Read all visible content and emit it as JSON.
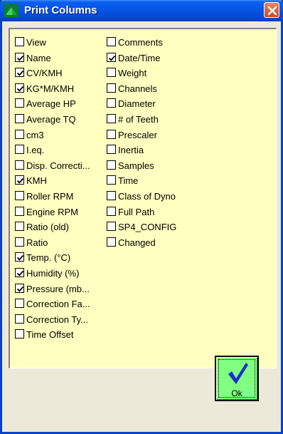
{
  "window": {
    "title": "Print Columns"
  },
  "columns_left": [
    {
      "label": "View",
      "checked": false
    },
    {
      "label": "Name",
      "checked": true
    },
    {
      "label": "CV/KMH",
      "checked": true
    },
    {
      "label": "KG*M/KMH",
      "checked": true
    },
    {
      "label": "Average HP",
      "checked": false
    },
    {
      "label": "Average TQ",
      "checked": false
    },
    {
      "label": "cm3",
      "checked": false
    },
    {
      "label": "I.eq.",
      "checked": false
    },
    {
      "label": "Disp. Correcti...",
      "checked": false
    },
    {
      "label": "KMH",
      "checked": true
    },
    {
      "label": "Roller RPM",
      "checked": false
    },
    {
      "label": "Engine RPM",
      "checked": false
    },
    {
      "label": "Ratio (old)",
      "checked": false
    },
    {
      "label": "Ratio",
      "checked": false
    },
    {
      "label": "Temp. (°C)",
      "checked": true
    },
    {
      "label": "Humidity (%)",
      "checked": true
    },
    {
      "label": "Pressure (mb...",
      "checked": true
    },
    {
      "label": "Correction Fa...",
      "checked": false
    },
    {
      "label": "Correction Ty...",
      "checked": false
    },
    {
      "label": "Time Offset",
      "checked": false
    }
  ],
  "columns_right": [
    {
      "label": "Comments",
      "checked": false
    },
    {
      "label": "Date/Time",
      "checked": true
    },
    {
      "label": "Weight",
      "checked": false
    },
    {
      "label": "Channels",
      "checked": false
    },
    {
      "label": "Diameter",
      "checked": false
    },
    {
      "label": "# of Teeth",
      "checked": false
    },
    {
      "label": "Prescaler",
      "checked": false
    },
    {
      "label": "Inertia",
      "checked": false
    },
    {
      "label": "Samples",
      "checked": false
    },
    {
      "label": "Time",
      "checked": false
    },
    {
      "label": "Class of Dyno",
      "checked": false
    },
    {
      "label": "Full Path",
      "checked": false
    },
    {
      "label": "SP4_CONFIG",
      "checked": false
    },
    {
      "label": "Changed",
      "checked": false
    }
  ],
  "buttons": {
    "ok_label": "Ok"
  },
  "colors": {
    "panel": "#ffffc0",
    "ok_button": "#80ff80",
    "titlebar": "#0554e3",
    "close": "#d0491e"
  }
}
